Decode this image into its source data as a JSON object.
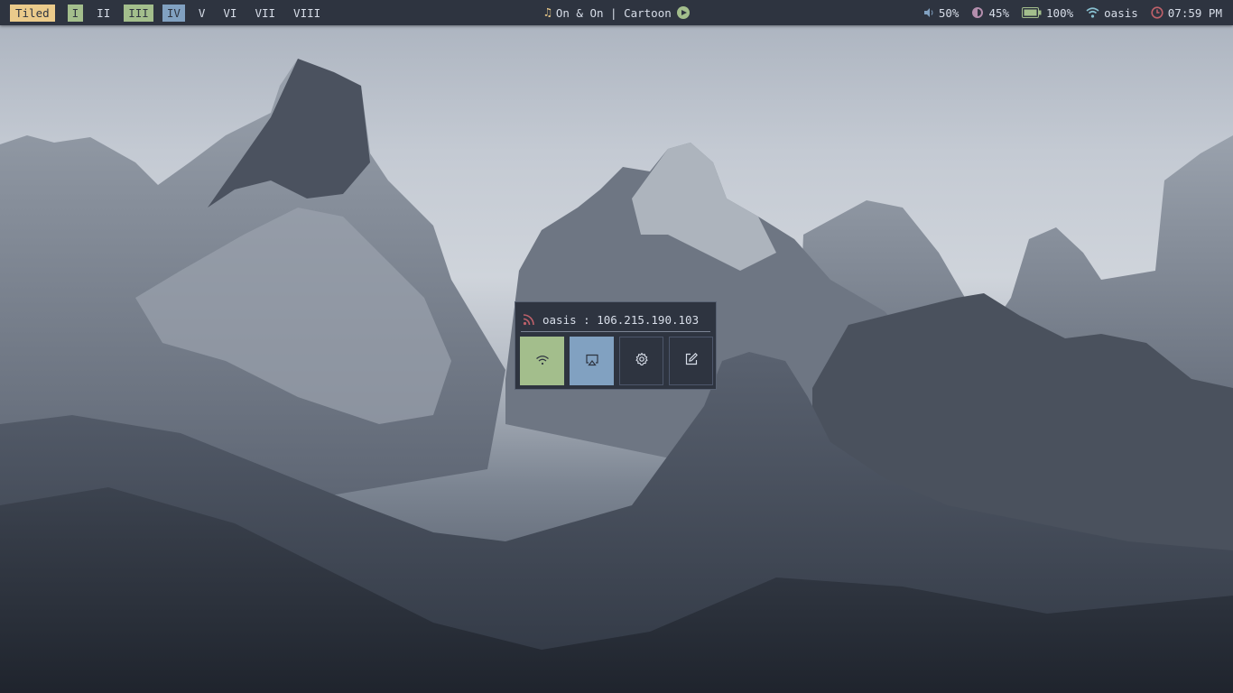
{
  "topbar": {
    "layout_label": "Tiled",
    "workspaces": [
      {
        "label": "I",
        "state": "occupied"
      },
      {
        "label": "II",
        "state": "empty"
      },
      {
        "label": "III",
        "state": "occupied"
      },
      {
        "label": "IV",
        "state": "active"
      },
      {
        "label": "V",
        "state": "empty"
      },
      {
        "label": "VI",
        "state": "empty"
      },
      {
        "label": "VII",
        "state": "empty"
      },
      {
        "label": "VIII",
        "state": "empty"
      }
    ],
    "now_playing": "On & On | Cartoon",
    "volume": "50%",
    "brightness": "45%",
    "battery": "100%",
    "wifi_name": "oasis",
    "time": "07:59 PM"
  },
  "network_popup": {
    "title": "oasis : 106.215.190.103",
    "buttons": [
      {
        "icon": "wifi-icon",
        "state": "on"
      },
      {
        "icon": "airplay-icon",
        "state": "on"
      },
      {
        "icon": "gear-icon",
        "state": "off"
      },
      {
        "icon": "edit-icon",
        "state": "off"
      }
    ]
  },
  "colors": {
    "bar_bg": "#2e3440",
    "text": "#d8dee9",
    "yellow": "#ebcb8b",
    "green": "#a3be8c",
    "blue": "#81a1c1",
    "red": "#bf616a",
    "purple": "#b48ead"
  }
}
